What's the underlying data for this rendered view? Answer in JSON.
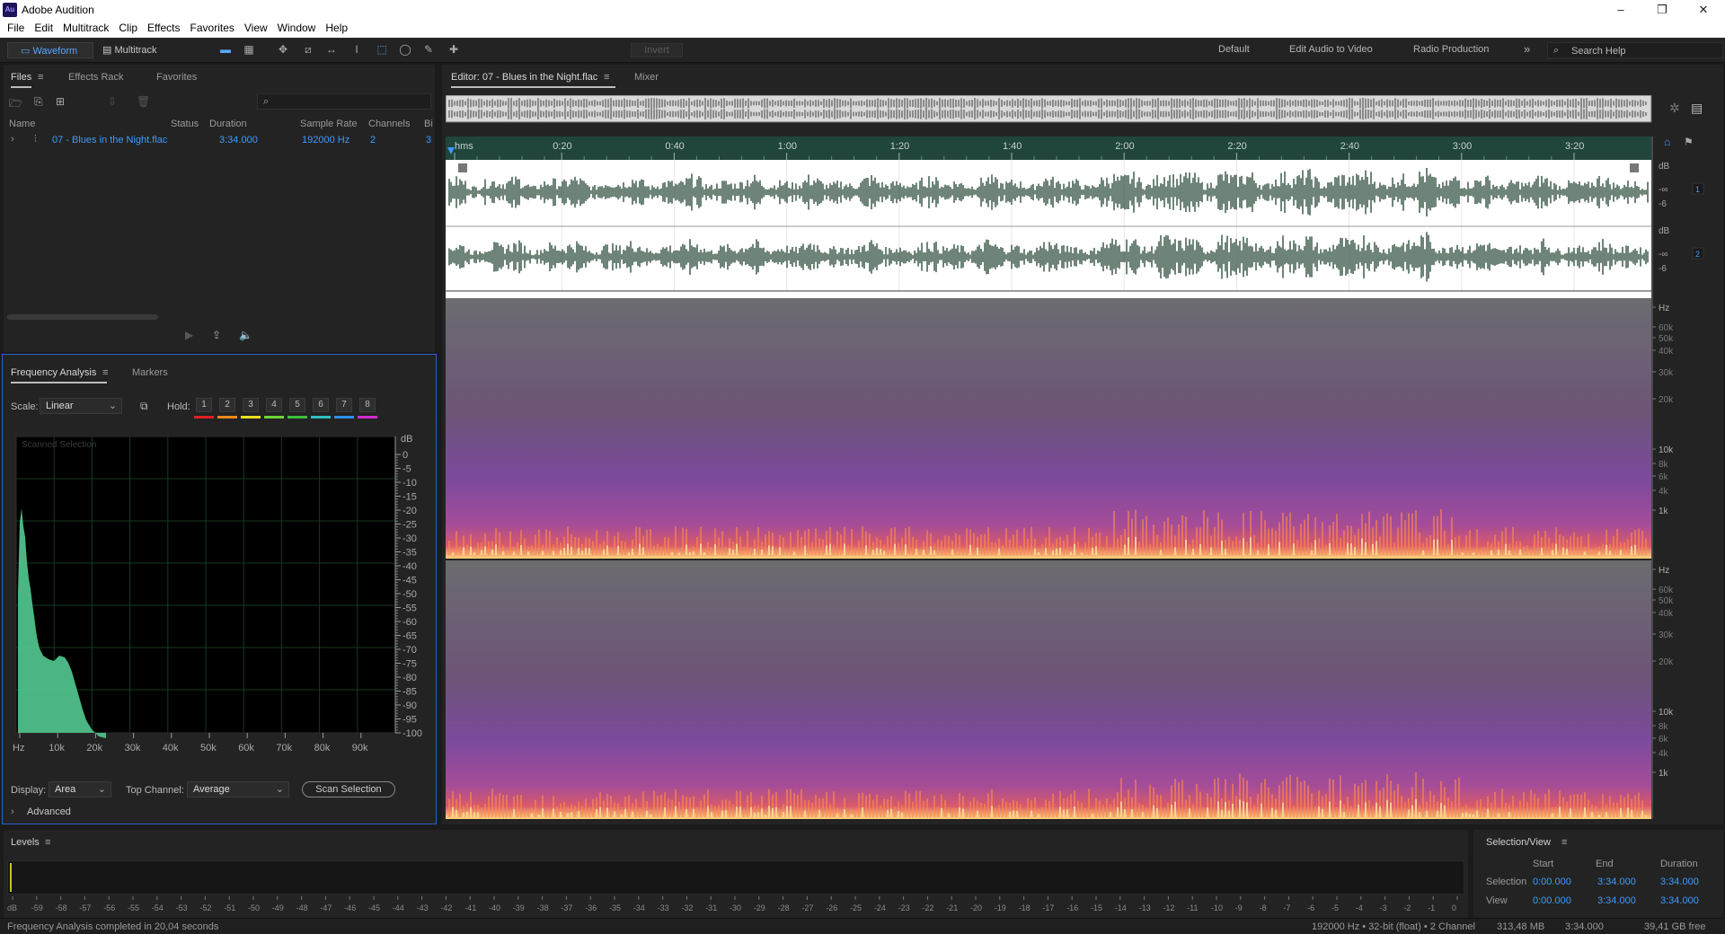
{
  "window": {
    "title": "Adobe Audition",
    "logo": "Au",
    "minimize": "–",
    "restore": "❐",
    "close": "✕"
  },
  "menu": [
    "File",
    "Edit",
    "Multitrack",
    "Clip",
    "Effects",
    "Favorites",
    "View",
    "Window",
    "Help"
  ],
  "toolbar": {
    "waveform": "Waveform",
    "multitrack": "Multitrack",
    "invert": "Invert",
    "workspaces": [
      "Default",
      "Edit Audio to Video",
      "Radio Production"
    ],
    "more": "»",
    "search_placeholder": "Search Help"
  },
  "files_panel": {
    "tabs": [
      "Files",
      "Effects Rack",
      "Favorites"
    ],
    "columns": [
      "Name",
      "Status",
      "Duration",
      "Sample Rate",
      "Channels",
      "Bi"
    ],
    "rows": [
      {
        "name": "07 - Blues in the Night.flac",
        "status": "",
        "duration": "3:34.000",
        "sample_rate": "192000 Hz",
        "channels": "2",
        "bits": "3"
      }
    ]
  },
  "freq_panel": {
    "tabs": [
      "Frequency Analysis",
      "Markers"
    ],
    "scale_label": "Scale:",
    "scale_value": "Linear",
    "hold_label": "Hold:",
    "hold_buttons": [
      "1",
      "2",
      "3",
      "4",
      "5",
      "6",
      "7",
      "8"
    ],
    "hold_colors": [
      "#e02020",
      "#f08a1c",
      "#e8e020",
      "#6ad63a",
      "#3fbf3f",
      "#2fc0c0",
      "#2c8ff0",
      "#d02ad0"
    ],
    "overlay": "Scanned Selection",
    "db_label": "dB",
    "db_ticks": [
      "0",
      "-5",
      "-10",
      "-15",
      "-20",
      "-25",
      "-30",
      "-35",
      "-40",
      "-45",
      "-50",
      "-55",
      "-60",
      "-65",
      "-70",
      "-75",
      "-80",
      "-85",
      "-90",
      "-95",
      "-100"
    ],
    "hz_ticks": [
      "Hz",
      "10k",
      "20k",
      "30k",
      "40k",
      "50k",
      "60k",
      "70k",
      "80k",
      "90k"
    ],
    "display_label": "Display:",
    "display_value": "Area",
    "top_channel_label": "Top Channel:",
    "top_channel_value": "Average",
    "scan_button": "Scan Selection",
    "advanced": "Advanced",
    "area_color": "#4fc08a"
  },
  "editor": {
    "tab": "Editor: 07 - Blues in the Night.flac",
    "mixer": "Mixer",
    "time_ticks": [
      "hms",
      "0:20",
      "0:40",
      "1:00",
      "1:20",
      "1:40",
      "2:00",
      "2:20",
      "2:40",
      "3:00",
      "3:20"
    ],
    "db_label": "dB",
    "db_values": [
      "-∞",
      "-6"
    ],
    "channels": [
      "1",
      "2"
    ],
    "spec_ticks": [
      "Hz",
      "60k",
      "50k",
      "40k",
      "30k",
      "20k",
      "10k",
      "8k",
      "6k",
      "4k",
      "1k"
    ],
    "waveform_color": "#3e5a4c"
  },
  "levels": {
    "title": "Levels",
    "ticks": [
      "dB",
      "-59",
      "-58",
      "-57",
      "-56",
      "-55",
      "-54",
      "-53",
      "-52",
      "-51",
      "-50",
      "-49",
      "-48",
      "-47",
      "-46",
      "-45",
      "-44",
      "-43",
      "-42",
      "-41",
      "-40",
      "-39",
      "-38",
      "-37",
      "-36",
      "-35",
      "-34",
      "-33",
      "-32",
      "-31",
      "-30",
      "-29",
      "-28",
      "-27",
      "-26",
      "-25",
      "-24",
      "-23",
      "-22",
      "-21",
      "-20",
      "-19",
      "-18",
      "-17",
      "-16",
      "-15",
      "-14",
      "-13",
      "-12",
      "-11",
      "-10",
      "-9",
      "-8",
      "-7",
      "-6",
      "-5",
      "-4",
      "-3",
      "-2",
      "-1",
      "0"
    ]
  },
  "selection_view": {
    "title": "Selection/View",
    "headers": [
      "Start",
      "End",
      "Duration"
    ],
    "rows": [
      {
        "label": "Selection",
        "start": "0:00.000",
        "end": "3:34.000",
        "duration": "3:34.000"
      },
      {
        "label": "View",
        "start": "0:00.000",
        "end": "3:34.000",
        "duration": "3:34.000"
      }
    ]
  },
  "status": {
    "message": "Frequency Analysis completed in 20,04 seconds",
    "format": "192000 Hz • 32-bit (float) • 2 Channel",
    "size": "313,48 MB",
    "duration": "3:34.000",
    "free": "39,41 GB free"
  }
}
